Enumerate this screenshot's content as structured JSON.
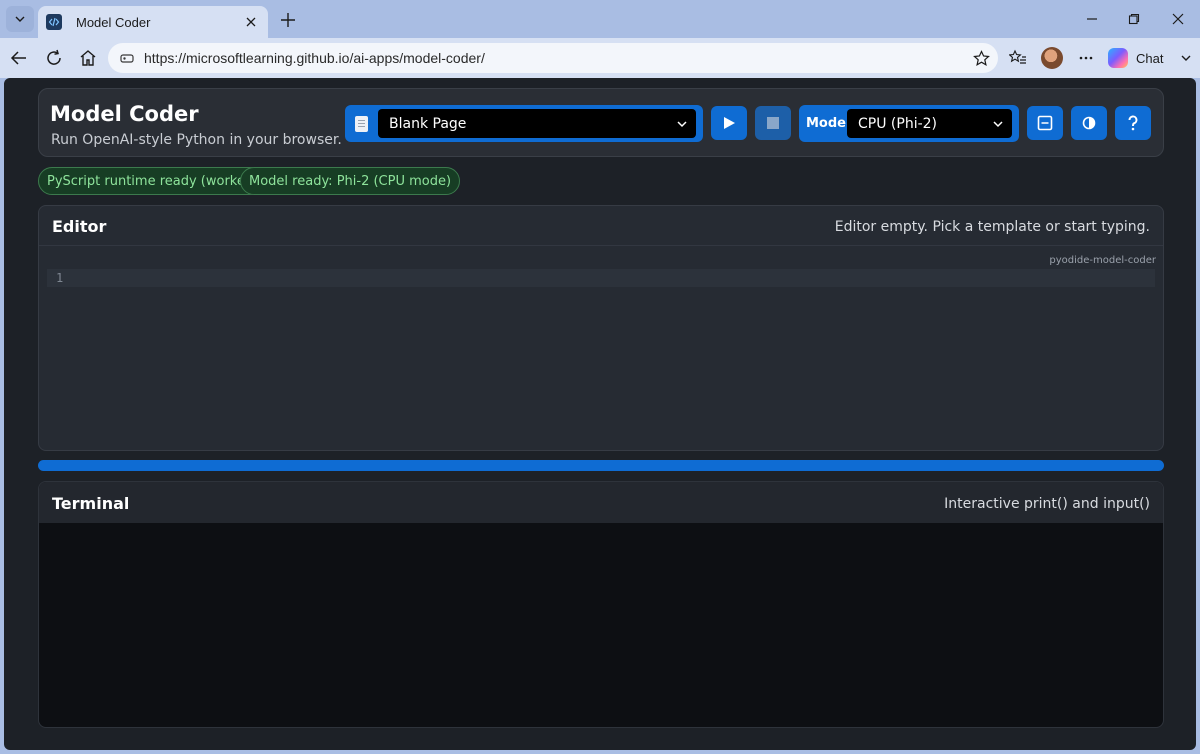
{
  "browser": {
    "tab_title": "Model Coder",
    "url": "https://microsoftlearning.github.io/ai-apps/model-coder/",
    "chat_label": "Chat"
  },
  "app": {
    "title": "Model Coder",
    "subtitle": "Run OpenAI-style Python in your browser.",
    "template_select": "Blank Page",
    "mode_label": "Mode",
    "mode_select": "CPU (Phi-2)"
  },
  "status": {
    "runtime": "PyScript runtime ready (worker)",
    "model": "Model ready: Phi-2 (CPU mode)"
  },
  "editor": {
    "title": "Editor",
    "note": "Editor empty. Pick a template or start typing.",
    "tag": "pyodide-model-coder",
    "line_number": "1"
  },
  "terminal": {
    "title": "Terminal",
    "note": "Interactive print() and input()"
  },
  "colors": {
    "accent": "#0f6cd3",
    "badge_text": "#8ee39b",
    "page_bg": "#1d2127"
  }
}
